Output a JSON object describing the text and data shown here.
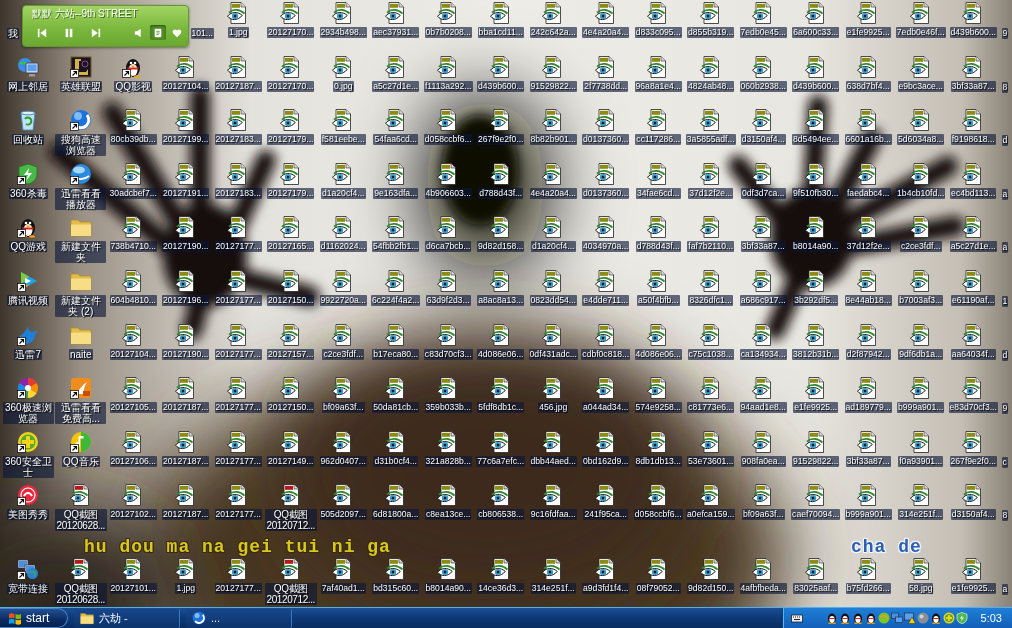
{
  "media_player": {
    "title": "默默 六站--9th STREET",
    "buttons": [
      {
        "kind": "previous",
        "pressed": false
      },
      {
        "kind": "pause",
        "pressed": false
      },
      {
        "kind": "next",
        "pressed": false
      },
      {
        "kind": "volume",
        "pressed": false
      },
      {
        "kind": "lyrics",
        "pressed": true
      },
      {
        "kind": "favorite",
        "pressed": false
      }
    ]
  },
  "desktop_rows": [
    {
      "icons": [
        {
          "label": "我",
          "kind": "computer"
        },
        {
          "label": "101...",
          "kind": "jpg"
        },
        {
          "label": "1.jpg",
          "kind": "jpg"
        },
        {
          "label": "20127170...",
          "kind": "jpg"
        },
        {
          "label": "2934b498...",
          "kind": "jpg"
        },
        {
          "label": "aec37931...",
          "kind": "jpg"
        },
        {
          "label": "0b7b0208...",
          "kind": "jpg"
        },
        {
          "label": "bba1cd11...",
          "kind": "jpg"
        },
        {
          "label": "242c642a...",
          "kind": "jpg"
        },
        {
          "label": "4e4a20a4...",
          "kind": "jpg"
        },
        {
          "label": "d833c095...",
          "kind": "jpg"
        },
        {
          "label": "d855b319...",
          "kind": "jpg"
        },
        {
          "label": "7edb0e45...",
          "kind": "jpg"
        },
        {
          "label": "6a600c33...",
          "kind": "jpg"
        },
        {
          "label": "e1fe9925...",
          "kind": "jpg"
        },
        {
          "label": "7edb0e46f...",
          "kind": "jpg"
        },
        {
          "label": "d439b600...",
          "kind": "jpg"
        }
      ],
      "edge_label": "9"
    },
    {
      "icons": [
        {
          "label": "网上邻居",
          "kind": "network"
        },
        {
          "label": "英雄联盟",
          "kind": "game"
        },
        {
          "label": "QQ影视",
          "kind": "penguin"
        },
        {
          "label": "20127104...",
          "kind": "jpg"
        },
        {
          "label": "20127187...",
          "kind": "jpg"
        },
        {
          "label": "20127170...",
          "kind": "jpg"
        },
        {
          "label": "0.jpg",
          "kind": "jpg"
        },
        {
          "label": "a5c27d1e...",
          "kind": "jpg"
        },
        {
          "label": "f1113a292...",
          "kind": "jpg"
        },
        {
          "label": "d439b600...",
          "kind": "jpg"
        },
        {
          "label": "91529822...",
          "kind": "jpg"
        },
        {
          "label": "2f7738dd...",
          "kind": "jpg"
        },
        {
          "label": "96a8a1e4...",
          "kind": "jpg"
        },
        {
          "label": "4824ab48...",
          "kind": "jpg"
        },
        {
          "label": "060b2938...",
          "kind": "jpg"
        },
        {
          "label": "d439b600...",
          "kind": "jpg"
        },
        {
          "label": "638d7bf4...",
          "kind": "jpg"
        },
        {
          "label": "e9bc3ace...",
          "kind": "jpg"
        },
        {
          "label": "3bf33a87...",
          "kind": "jpg"
        }
      ],
      "edge_label": "8"
    },
    {
      "icons": [
        {
          "label": "回收站",
          "kind": "recycle"
        },
        {
          "label": "搜狗高速浏览器",
          "kind": "sogou"
        },
        {
          "label": "80cb39db...",
          "kind": "jpg"
        },
        {
          "label": "20127199...",
          "kind": "jpg"
        },
        {
          "label": "20127183...",
          "kind": "jpg"
        },
        {
          "label": "20127179...",
          "kind": "jpg"
        },
        {
          "label": "f581eebe...",
          "kind": "jpg"
        },
        {
          "label": "54faa6cd...",
          "kind": "jpg"
        },
        {
          "label": "d058ccbf6...",
          "kind": "jpg"
        },
        {
          "label": "267f9e2f0...",
          "kind": "jpg"
        },
        {
          "label": "8b82b901...",
          "kind": "jpg"
        },
        {
          "label": "d0137360...",
          "kind": "jpg"
        },
        {
          "label": "cc117286...",
          "kind": "jpg"
        },
        {
          "label": "3a5855adf...",
          "kind": "jpg"
        },
        {
          "label": "d3150af4...",
          "kind": "jpg"
        },
        {
          "label": "8d5494ee...",
          "kind": "jpg"
        },
        {
          "label": "6601a16b...",
          "kind": "jpg"
        },
        {
          "label": "5d6034a8...",
          "kind": "jpg"
        },
        {
          "label": "f9198618...",
          "kind": "jpg"
        }
      ],
      "edge_label": "d"
    },
    {
      "icons": [
        {
          "label": "360杀毒",
          "kind": "shield"
        },
        {
          "label": "迅雷看看播放器",
          "kind": "sphere"
        },
        {
          "label": "30adcbef7...",
          "kind": "jpg"
        },
        {
          "label": "20127191...",
          "kind": "jpg"
        },
        {
          "label": "20127183...",
          "kind": "jpg"
        },
        {
          "label": "20127179...",
          "kind": "jpg"
        },
        {
          "label": "d1a20cf4...",
          "kind": "jpg"
        },
        {
          "label": "9e163dfa...",
          "kind": "jpg"
        },
        {
          "label": "4b906603...",
          "kind": "jpg"
        },
        {
          "label": "d788d43f...",
          "kind": "jpg"
        },
        {
          "label": "4e4a20a4...",
          "kind": "jpg"
        },
        {
          "label": "d0137360...",
          "kind": "jpg"
        },
        {
          "label": "34fae6cd...",
          "kind": "jpg"
        },
        {
          "label": "37d12f2e...",
          "kind": "jpg"
        },
        {
          "label": "0df3d7ca...",
          "kind": "jpg"
        },
        {
          "label": "9f510fb30...",
          "kind": "jpg"
        },
        {
          "label": "faedabc4...",
          "kind": "jpg"
        },
        {
          "label": "1b4cb10fd...",
          "kind": "jpg"
        },
        {
          "label": "ec4bd113...",
          "kind": "jpg"
        }
      ],
      "edge_label": "a"
    },
    {
      "icons": [
        {
          "label": "QQ游戏",
          "kind": "penguin"
        },
        {
          "label": "新建文件夹",
          "kind": "folder"
        },
        {
          "label": "738b4710...",
          "kind": "jpg"
        },
        {
          "label": "20127190...",
          "kind": "jpg"
        },
        {
          "label": "20127177...",
          "kind": "jpg"
        },
        {
          "label": "20127165...",
          "kind": "jpg"
        },
        {
          "label": "d1162024...",
          "kind": "jpg"
        },
        {
          "label": "54fbb2fb1...",
          "kind": "jpg"
        },
        {
          "label": "d6ca7bcb...",
          "kind": "jpg"
        },
        {
          "label": "9d82d158...",
          "kind": "jpg"
        },
        {
          "label": "d1a20cf4...",
          "kind": "jpg"
        },
        {
          "label": "4034970a...",
          "kind": "jpg"
        },
        {
          "label": "d788d43f...",
          "kind": "jpg"
        },
        {
          "label": "faf7b2110...",
          "kind": "jpg"
        },
        {
          "label": "3bf33a87...",
          "kind": "jpg"
        },
        {
          "label": "b8014a90...",
          "kind": "jpg"
        },
        {
          "label": "37d12f2e...",
          "kind": "jpg"
        },
        {
          "label": "c2ce3fdf...",
          "kind": "jpg"
        },
        {
          "label": "a5c27d1e...",
          "kind": "jpg"
        }
      ],
      "edge_label": "a"
    },
    {
      "icons": [
        {
          "label": "腾讯视频",
          "kind": "video"
        },
        {
          "label": "新建文件夹 (2)",
          "kind": "folder"
        },
        {
          "label": "604b4810...",
          "kind": "jpg"
        },
        {
          "label": "20127196...",
          "kind": "jpg"
        },
        {
          "label": "20127177...",
          "kind": "jpg"
        },
        {
          "label": "20127150...",
          "kind": "jpg"
        },
        {
          "label": "9922720a...",
          "kind": "jpg"
        },
        {
          "label": "6c224f4a2...",
          "kind": "jpg"
        },
        {
          "label": "63d9f2d3...",
          "kind": "jpg"
        },
        {
          "label": "a8ac8a13...",
          "kind": "jpg"
        },
        {
          "label": "0823dd54...",
          "kind": "jpg"
        },
        {
          "label": "e4dde711...",
          "kind": "jpg"
        },
        {
          "label": "a50f4bfb...",
          "kind": "jpg"
        },
        {
          "label": "8326dfc1...",
          "kind": "jpg"
        },
        {
          "label": "a686c917...",
          "kind": "jpg"
        },
        {
          "label": "3b292df5...",
          "kind": "jpg"
        },
        {
          "label": "8e44ab18...",
          "kind": "jpg"
        },
        {
          "label": "b7003af3...",
          "kind": "jpg"
        },
        {
          "label": "e61190af...",
          "kind": "jpg"
        }
      ],
      "edge_label": "1"
    },
    {
      "icons": [
        {
          "label": "迅雷7",
          "kind": "bird"
        },
        {
          "label": "naite",
          "kind": "folder"
        },
        {
          "label": "20127104...",
          "kind": "jpg"
        },
        {
          "label": "20127190...",
          "kind": "jpg"
        },
        {
          "label": "20127177...",
          "kind": "jpg"
        },
        {
          "label": "20127157...",
          "kind": "jpg"
        },
        {
          "label": "c2ce3fdf...",
          "kind": "jpg"
        },
        {
          "label": "b17eca80...",
          "kind": "jpg"
        },
        {
          "label": "c83d70cf3...",
          "kind": "jpg"
        },
        {
          "label": "4d086e06...",
          "kind": "jpg"
        },
        {
          "label": "0df431adc...",
          "kind": "jpg"
        },
        {
          "label": "cdbf0c818...",
          "kind": "jpg"
        },
        {
          "label": "4d086e06...",
          "kind": "jpg"
        },
        {
          "label": "c75c1038...",
          "kind": "jpg"
        },
        {
          "label": "ca134934...",
          "kind": "jpg"
        },
        {
          "label": "3812b31b...",
          "kind": "jpg"
        },
        {
          "label": "d2f87942...",
          "kind": "jpg"
        },
        {
          "label": "9df6db1a...",
          "kind": "jpg"
        },
        {
          "label": "aa64034f...",
          "kind": "jpg"
        }
      ],
      "edge_label": "d"
    },
    {
      "icons": [
        {
          "label": "360极速浏览器",
          "kind": "pinwheel"
        },
        {
          "label": "迅雷看看免费高...",
          "kind": "hd"
        },
        {
          "label": "20127105...",
          "kind": "jpg"
        },
        {
          "label": "20127187...",
          "kind": "jpg"
        },
        {
          "label": "20127177...",
          "kind": "jpg"
        },
        {
          "label": "20127150...",
          "kind": "jpg"
        },
        {
          "label": "bf09a63f...",
          "kind": "jpg"
        },
        {
          "label": "50da81cb...",
          "kind": "jpg"
        },
        {
          "label": "359b033b...",
          "kind": "jpg"
        },
        {
          "label": "5fdf8db1c...",
          "kind": "jpg"
        },
        {
          "label": "456.jpg",
          "kind": "jpg"
        },
        {
          "label": "a044ad34...",
          "kind": "jpg"
        },
        {
          "label": "574e9258...",
          "kind": "jpg"
        },
        {
          "label": "c81773e6...",
          "kind": "jpg"
        },
        {
          "label": "94aad1e8...",
          "kind": "jpg"
        },
        {
          "label": "e1fe9925...",
          "kind": "jpg"
        },
        {
          "label": "ad189779...",
          "kind": "jpg"
        },
        {
          "label": "b999a901...",
          "kind": "jpg"
        },
        {
          "label": "e83d70cf3...",
          "kind": "jpg"
        }
      ],
      "edge_label": "9"
    },
    {
      "icons": [
        {
          "label": "360安全卫士",
          "kind": "plus"
        },
        {
          "label": "QQ音乐",
          "kind": "music"
        },
        {
          "label": "20127106...",
          "kind": "jpg"
        },
        {
          "label": "20127187...",
          "kind": "jpg"
        },
        {
          "label": "20127177...",
          "kind": "jpg"
        },
        {
          "label": "20127149...",
          "kind": "jpg"
        },
        {
          "label": "962d0407...",
          "kind": "jpg"
        },
        {
          "label": "d31b0cf4...",
          "kind": "jpg"
        },
        {
          "label": "321a828b...",
          "kind": "jpg"
        },
        {
          "label": "77c6a7efc...",
          "kind": "jpg"
        },
        {
          "label": "dbb44aed...",
          "kind": "jpg"
        },
        {
          "label": "0bd162d9...",
          "kind": "jpg"
        },
        {
          "label": "8db1db13...",
          "kind": "jpg"
        },
        {
          "label": "53e73601...",
          "kind": "jpg"
        },
        {
          "label": "908fa0ea...",
          "kind": "jpg"
        },
        {
          "label": "91529822...",
          "kind": "jpg"
        },
        {
          "label": "3bf33a87...",
          "kind": "jpg"
        },
        {
          "label": "f0a93901...",
          "kind": "jpg"
        },
        {
          "label": "267f9e2f0...",
          "kind": "jpg"
        }
      ],
      "edge_label": "c"
    },
    {
      "icons": [
        {
          "label": "美图秀秀",
          "kind": "ring"
        },
        {
          "label": "QQ截图20120628...",
          "kind": "png"
        },
        {
          "label": "20127102...",
          "kind": "jpg"
        },
        {
          "label": "20127187...",
          "kind": "jpg"
        },
        {
          "label": "20127177...",
          "kind": "jpg"
        },
        {
          "label": "QQ截图20120712...",
          "kind": "png"
        },
        {
          "label": "505d2097...",
          "kind": "jpg"
        },
        {
          "label": "6d81800a...",
          "kind": "jpg"
        },
        {
          "label": "c8ea13ce...",
          "kind": "jpg"
        },
        {
          "label": "cb806538...",
          "kind": "jpg"
        },
        {
          "label": "9c16fdfaa...",
          "kind": "jpg"
        },
        {
          "label": "241f95ca...",
          "kind": "jpg"
        },
        {
          "label": "d058ccbf6...",
          "kind": "jpg"
        },
        {
          "label": "a0efca159...",
          "kind": "jpg"
        },
        {
          "label": "bf09a63f...",
          "kind": "jpg"
        },
        {
          "label": "caef70094...",
          "kind": "jpg"
        },
        {
          "label": "b999a901...",
          "kind": "jpg"
        },
        {
          "label": "314e251f...",
          "kind": "jpg"
        },
        {
          "label": "d3150af4...",
          "kind": "jpg"
        }
      ],
      "edge_label": "8"
    },
    {
      "icons": [
        {
          "label": "宽带连接",
          "kind": "connection"
        },
        {
          "label": "QQ截图20120628...",
          "kind": "png"
        },
        {
          "label": "20127101...",
          "kind": "jpg"
        },
        {
          "label": "1.jpg",
          "kind": "jpg"
        },
        {
          "label": "20127177...",
          "kind": "jpg"
        },
        {
          "label": "QQ截图20120712...",
          "kind": "png"
        },
        {
          "label": "7af40ad1...",
          "kind": "jpg"
        },
        {
          "label": "bd315c60...",
          "kind": "jpg"
        },
        {
          "label": "b8014a90...",
          "kind": "jpg"
        },
        {
          "label": "14ce36d3...",
          "kind": "jpg"
        },
        {
          "label": "314e251f...",
          "kind": "jpg"
        },
        {
          "label": "a9d3fd1f4...",
          "kind": "jpg"
        },
        {
          "label": "08f79052...",
          "kind": "jpg"
        },
        {
          "label": "9d82d150...",
          "kind": "jpg"
        },
        {
          "label": "4afbfbeda...",
          "kind": "jpg"
        },
        {
          "label": "83025aaf...",
          "kind": "jpg"
        },
        {
          "label": "b75fd266...",
          "kind": "jpg"
        },
        {
          "label": "58.jpg",
          "kind": "jpg"
        },
        {
          "label": "e1fe9925...",
          "kind": "jpg"
        }
      ],
      "edge_label": "a"
    }
  ],
  "lyrics": [
    {
      "text": "hu dou ma na gei tui ni ga",
      "color": "#d6c81c"
    },
    {
      "text": "cha de",
      "color": "#2c5fb4"
    }
  ],
  "taskbar": {
    "start_label": "start",
    "tasks": [
      {
        "label": "六劫 -",
        "kind": "folder"
      },
      {
        "label": "...",
        "kind": "sogou"
      }
    ],
    "tray_icons": [
      {
        "kind": "keyboard"
      },
      {
        "kind": "penguin"
      },
      {
        "kind": "penguin"
      },
      {
        "kind": "penguin"
      },
      {
        "kind": "penguin"
      },
      {
        "kind": "ball"
      },
      {
        "kind": "network"
      },
      {
        "kind": "warning"
      },
      {
        "kind": "sphere"
      },
      {
        "kind": "penguin"
      },
      {
        "kind": "plus"
      },
      {
        "kind": "shield"
      }
    ],
    "clock": "5:03"
  }
}
